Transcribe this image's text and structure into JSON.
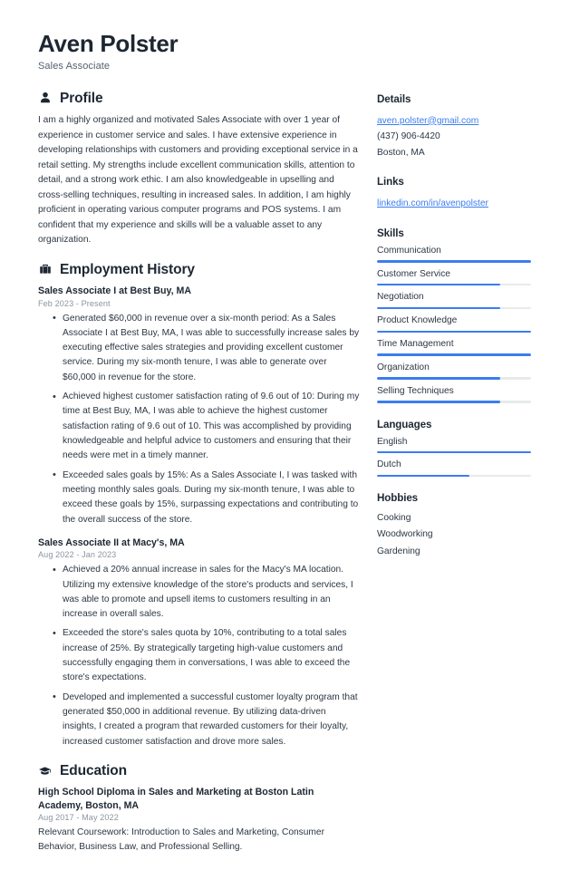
{
  "accent_color": "#3b7ded",
  "header": {
    "name": "Aven Polster",
    "title": "Sales Associate"
  },
  "sections": {
    "profile": {
      "icon": "user-icon",
      "title": "Profile",
      "text": "I am a highly organized and motivated Sales Associate with over 1 year of experience in customer service and sales. I have extensive experience in developing relationships with customers and providing exceptional service in a retail setting. My strengths include excellent communication skills, attention to detail, and a strong work ethic. I am also knowledgeable in upselling and cross-selling techniques, resulting in increased sales. In addition, I am highly proficient in operating various computer programs and POS systems. I am confident that my experience and skills will be a valuable asset to any organization."
    },
    "employment": {
      "icon": "briefcase-icon",
      "title": "Employment History",
      "entries": [
        {
          "title": "Sales Associate I at Best Buy, MA",
          "date": "Feb 2023 - Present",
          "bullets": [
            "Generated $60,000 in revenue over a six-month period: As a Sales Associate I at Best Buy, MA, I was able to successfully increase sales by executing effective sales strategies and providing excellent customer service. During my six-month tenure, I was able to generate over $60,000 in revenue for the store.",
            "Achieved highest customer satisfaction rating of 9.6 out of 10: During my time at Best Buy, MA, I was able to achieve the highest customer satisfaction rating of 9.6 out of 10. This was accomplished by providing knowledgeable and helpful advice to customers and ensuring that their needs were met in a timely manner.",
            "Exceeded sales goals by 15%: As a Sales Associate I, I was tasked with meeting monthly sales goals. During my six-month tenure, I was able to exceed these goals by 15%, surpassing expectations and contributing to the overall success of the store."
          ]
        },
        {
          "title": "Sales Associate II at Macy's, MA",
          "date": "Aug 2022 - Jan 2023",
          "bullets": [
            "Achieved a 20% annual increase in sales for the Macy's MA location. Utilizing my extensive knowledge of the store's products and services, I was able to promote and upsell items to customers resulting in an increase in overall sales.",
            "Exceeded the store's sales quota by 10%, contributing to a total sales increase of 25%. By strategically targeting high-value customers and successfully engaging them in conversations, I was able to exceed the store's expectations.",
            "Developed and implemented a successful customer loyalty program that generated $50,000 in additional revenue. By utilizing data-driven insights, I created a program that rewarded customers for their loyalty, increased customer satisfaction and drove more sales."
          ]
        }
      ]
    },
    "education": {
      "icon": "graduation-cap-icon",
      "title": "Education",
      "entries": [
        {
          "title": "High School Diploma in Sales and Marketing at Boston Latin Academy, Boston, MA",
          "date": "Aug 2017 - May 2022",
          "description": "Relevant Coursework: Introduction to Sales and Marketing, Consumer Behavior, Business Law, and Professional Selling."
        }
      ]
    }
  },
  "sidebar": {
    "details": {
      "title": "Details",
      "email": "aven.polster@gmail.com",
      "phone": "(437) 906-4420",
      "location": "Boston, MA"
    },
    "links": {
      "title": "Links",
      "items": [
        {
          "label": "linkedin.com/in/avenpolster"
        }
      ]
    },
    "skills": {
      "title": "Skills",
      "items": [
        {
          "label": "Communication",
          "level": 100
        },
        {
          "label": "Customer Service",
          "level": 80
        },
        {
          "label": "Negotiation",
          "level": 80
        },
        {
          "label": "Product Knowledge",
          "level": 100
        },
        {
          "label": "Time Management",
          "level": 100
        },
        {
          "label": "Organization",
          "level": 80
        },
        {
          "label": "Selling Techniques",
          "level": 80
        }
      ]
    },
    "languages": {
      "title": "Languages",
      "items": [
        {
          "label": "English",
          "level": 100
        },
        {
          "label": "Dutch",
          "level": 60
        }
      ]
    },
    "hobbies": {
      "title": "Hobbies",
      "items": [
        {
          "label": "Cooking"
        },
        {
          "label": "Woodworking"
        },
        {
          "label": "Gardening"
        }
      ]
    }
  }
}
